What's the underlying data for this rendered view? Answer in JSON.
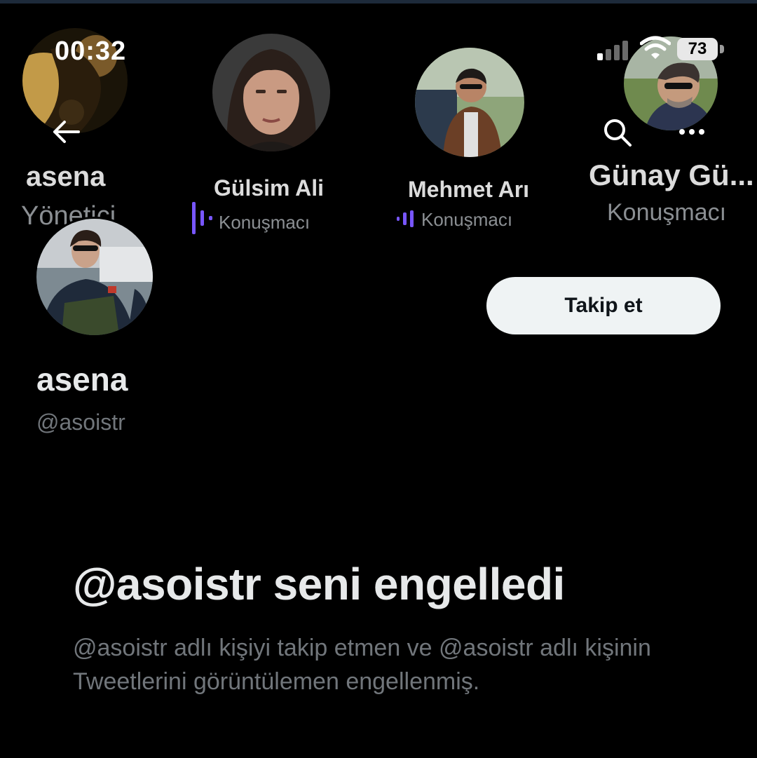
{
  "status_bar": {
    "time": "00:32",
    "battery": "73"
  },
  "speakers": [
    {
      "name": "asena",
      "role": "Yönetici"
    },
    {
      "name": "Gülsim Ali",
      "role": "Konuşmacı"
    },
    {
      "name": "Mehmet Arı",
      "role": "Konuşmacı"
    },
    {
      "name": "Günay Gü...",
      "role": "Konuşmacı"
    }
  ],
  "profile": {
    "display_name": "asena",
    "handle": "@asoistr",
    "follow_label": "Takip et"
  },
  "blocked": {
    "title": "@asoistr seni engelledi",
    "description": "@asoistr adlı kişiyi takip etmen ve @asoistr adlı kişinin Tweetlerini görüntülemen engellenmiş."
  },
  "colors": {
    "accent_wave": "#7856ff",
    "button_bg": "#eff3f4",
    "muted_text": "#71767b"
  },
  "icons": [
    "back-arrow-icon",
    "search-icon",
    "more-icon",
    "signal-icon",
    "wifi-icon",
    "battery-icon",
    "audio-wave-icon"
  ]
}
